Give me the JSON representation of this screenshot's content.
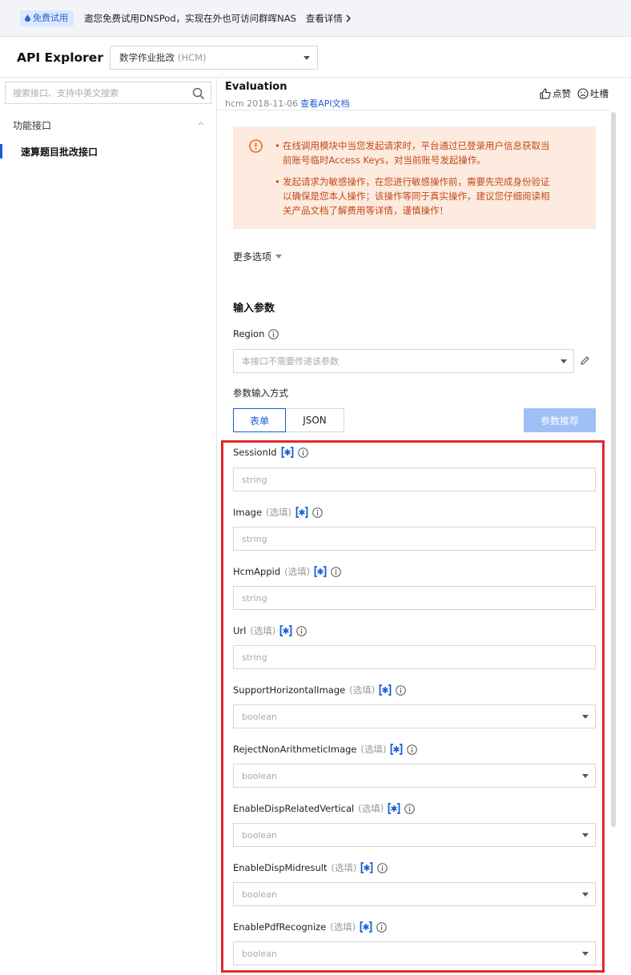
{
  "banner": {
    "tag": "免费试用",
    "text": "邀您免费试用DNSPod，实现在外也可访问群晖NAS",
    "link": "查看详情"
  },
  "topbar": {
    "brand": "API Explorer",
    "service": "数学作业批改",
    "service_code": "(HCM)"
  },
  "sidebar": {
    "search_placeholder": "搜索接口、支持中英文搜索",
    "group": "功能接口",
    "items": [
      "速算题目批改接口"
    ]
  },
  "main": {
    "title": "Evaluation",
    "subtitle": "hcm 2018-11-06",
    "doc_link": "查看API文档",
    "like": "点赞",
    "complain": "吐槽",
    "alerts": [
      [
        "在线调用模块中当您发起请求时，平台通过已登录用户信息获取当",
        "前账号临时Access Keys，对当前账号发起操作。"
      ],
      [
        "发起请求为敏感操作，在您进行敏感操作前，需要先完成身份验证",
        "以确保是您本人操作；该操作等同于真实操作，建议您仔细阅读相",
        "关产品文档了解费用等详情，谨慎操作！"
      ]
    ],
    "more_options": "更多选项",
    "section_title": "输入参数",
    "region_label": "Region",
    "region_placeholder": "本接口不需要传递该参数",
    "input_mode_label": "参数输入方式",
    "mode_form": "表单",
    "mode_json": "JSON",
    "recommend_button": "参数推荐",
    "optional_tag": "(选填)",
    "params": [
      {
        "name": "SessionId",
        "optional": false,
        "type": "string",
        "select": false
      },
      {
        "name": "Image",
        "optional": true,
        "type": "string",
        "select": false
      },
      {
        "name": "HcmAppid",
        "optional": true,
        "type": "string",
        "select": false
      },
      {
        "name": "Url",
        "optional": true,
        "type": "string",
        "select": false
      },
      {
        "name": "SupportHorizontalImage",
        "optional": true,
        "type": "boolean",
        "select": true
      },
      {
        "name": "RejectNonArithmeticImage",
        "optional": true,
        "type": "boolean",
        "select": true
      },
      {
        "name": "EnableDispRelatedVertical",
        "optional": true,
        "type": "boolean",
        "select": true
      },
      {
        "name": "EnableDispMidresult",
        "optional": true,
        "type": "boolean",
        "select": true
      },
      {
        "name": "EnablePdfRecognize",
        "optional": true,
        "type": "boolean",
        "select": true
      }
    ]
  },
  "colors": {
    "accent": "#1a5dd6",
    "alert_bg": "#fdebe0",
    "alert_text": "#c34a17",
    "highlight": "#e3262a"
  }
}
